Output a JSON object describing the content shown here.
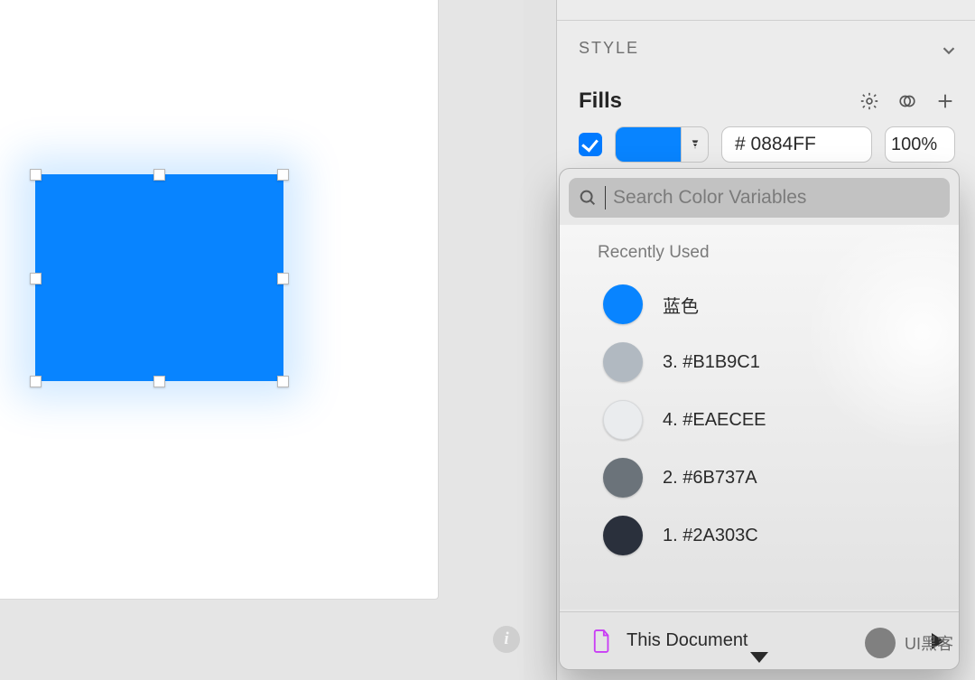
{
  "inspector": {
    "style_section_label": "STYLE",
    "fills": {
      "title": "Fills",
      "checked": true,
      "swatch_hex": "#0884FF",
      "hex_value": "# 0884FF",
      "opacity_value": "100%"
    }
  },
  "popover": {
    "search_placeholder": "Search Color Variables",
    "group_label": "Recently Used",
    "items": [
      {
        "name": "蓝色",
        "hex": "#0884FF"
      },
      {
        "name": "3. #B1B9C1",
        "hex": "#B1B9C1"
      },
      {
        "name": "4. #EAECEE",
        "hex": "#EAECEE"
      },
      {
        "name": "2. #6B737A",
        "hex": "#6B737A"
      },
      {
        "name": "1. #2A303C",
        "hex": "#2A303C"
      }
    ],
    "footer_label": "This Document"
  },
  "watermark": "UI黑客",
  "info_glyph": "i",
  "shape": {
    "fill": "#0884FF"
  }
}
